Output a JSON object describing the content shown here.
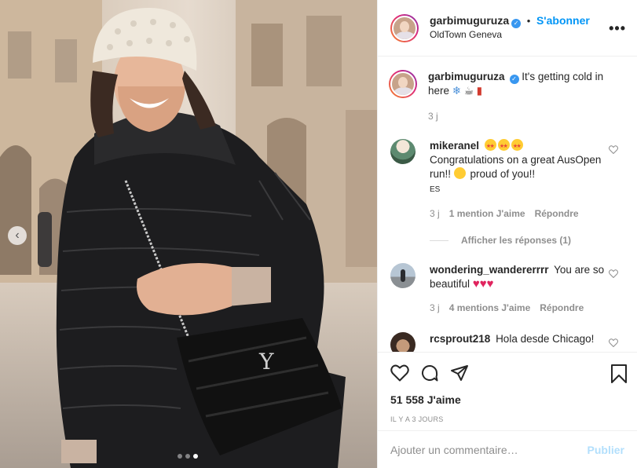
{
  "post": {
    "username": "garbimuguruza",
    "follow_label": "S'abonner",
    "separator": "•",
    "location": "OldTown Geneva",
    "more_label": "•••"
  },
  "caption": {
    "username": "garbimuguruza",
    "text": "It's getting cold in here",
    "time": "3 j"
  },
  "comments": [
    {
      "username": "mikeranel",
      "text": "Congratulations on a great AusOpen run!!",
      "text_after": "proud of you!!",
      "tag": "ES",
      "time": "3 j",
      "likes": "1 mention J'aime",
      "reply": "Répondre",
      "view_replies": "Afficher les réponses (1)"
    },
    {
      "username": "wondering_wandererrrr",
      "text": "You are so beautiful",
      "time": "3 j",
      "likes": "4 mentions J'aime",
      "reply": "Répondre"
    },
    {
      "username": "rcsprout218",
      "text": "Hola desde Chicago!"
    }
  ],
  "likes_count": "51 558 J'aime",
  "posted_ago": "IL Y A 3 JOURS",
  "add_comment": {
    "placeholder": "Ajouter un commentaire…",
    "publish_label": "Publier"
  },
  "carousel": {
    "slides": 3,
    "active_index": 2
  },
  "colors": {
    "link": "#0095f6",
    "publish_disabled": "#b2dffc",
    "heart": "#e0245e"
  },
  "icons": [
    "heart-icon",
    "comment-icon",
    "share-icon",
    "bookmark-icon",
    "verified-icon",
    "chevron-left-icon",
    "more-icon"
  ]
}
